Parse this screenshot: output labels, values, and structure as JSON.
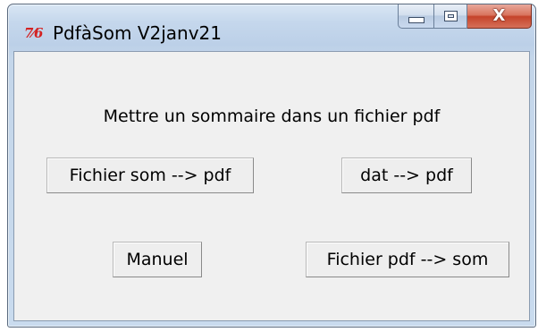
{
  "window": {
    "title": "PdfàSom V2janv21",
    "icon": "tk-feather-icon",
    "icon_glyph": "7⁄6",
    "accent": "#d32222"
  },
  "caption": {
    "minimize": "minimize-icon",
    "maximize": "maximize-icon",
    "close_glyph": "X"
  },
  "main": {
    "heading": "Mettre un sommaire dans un fichier pdf",
    "buttons": {
      "som_to_pdf": "Fichier som --> pdf",
      "dat_to_pdf": "dat --> pdf",
      "manuel": "Manuel",
      "pdf_to_som": "Fichier pdf --> som"
    }
  }
}
